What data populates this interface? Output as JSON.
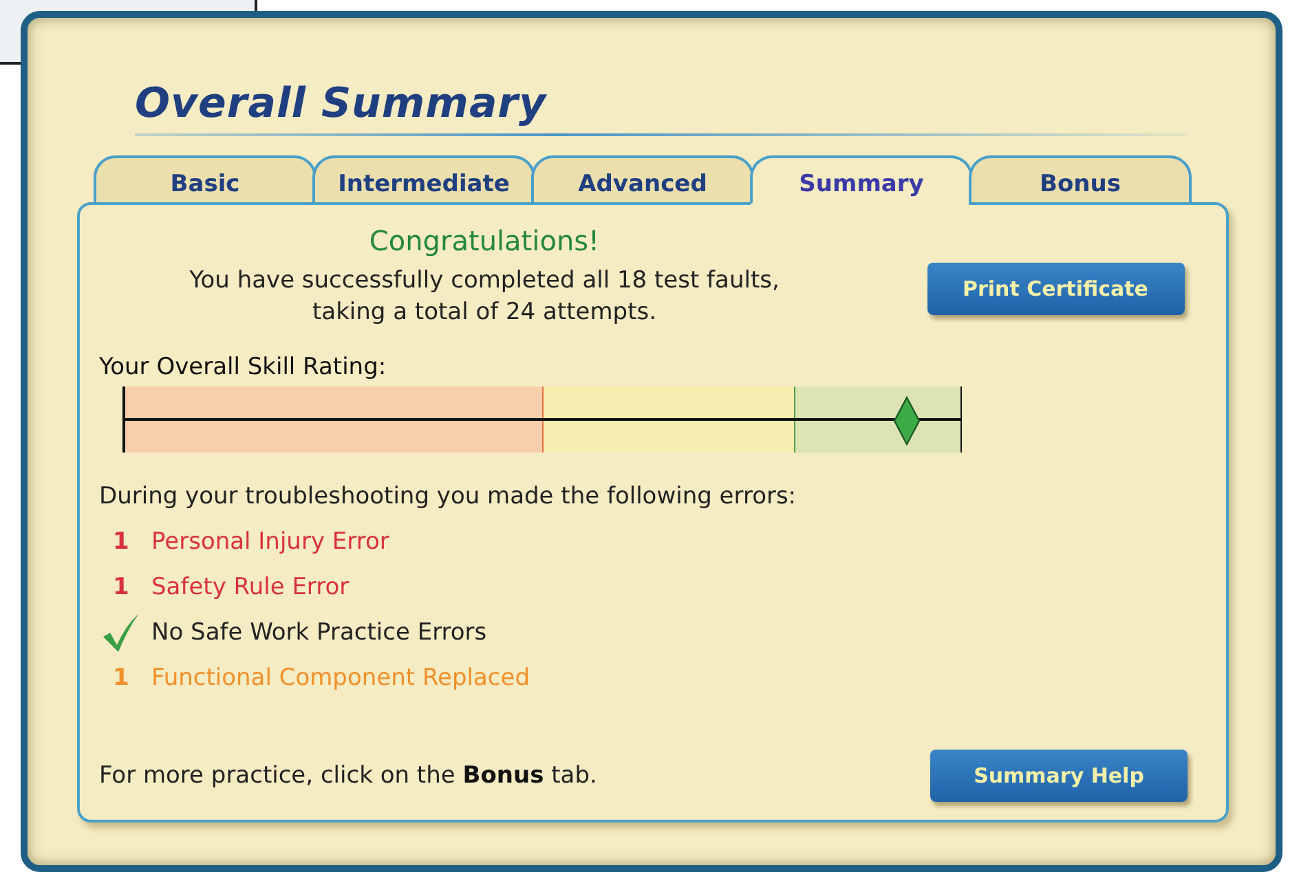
{
  "title": "Overall Summary",
  "tabs": [
    {
      "label": "Basic",
      "selected": false
    },
    {
      "label": "Intermediate",
      "selected": false
    },
    {
      "label": "Advanced",
      "selected": false
    },
    {
      "label": "Summary",
      "selected": true
    },
    {
      "label": "Bonus",
      "selected": false
    }
  ],
  "congratulations": "Congratulations!",
  "message": [
    "You have successfully completed all 18 test faults,",
    "taking a total of 24 attempts."
  ],
  "print_button": "Print Certificate",
  "rating": {
    "label": "Your Overall Skill Rating:",
    "level": 0.935
  },
  "errors_intro": "During your troubleshooting you made the following errors:",
  "errors": [
    {
      "kind": "count",
      "count": "1",
      "label": "Personal Injury Error",
      "color": "#d8333a"
    },
    {
      "kind": "count",
      "count": "1",
      "label": "Safety Rule Error",
      "color": "#d8333a"
    },
    {
      "kind": "check",
      "label": "No Safe Work Practice Errors"
    },
    {
      "kind": "count",
      "count": "1",
      "label": "Functional Component Replaced",
      "color": "#f0902a"
    }
  ],
  "footer": "For more practice, click on the **Bonus** tab.",
  "help_button": "Summary Help"
}
